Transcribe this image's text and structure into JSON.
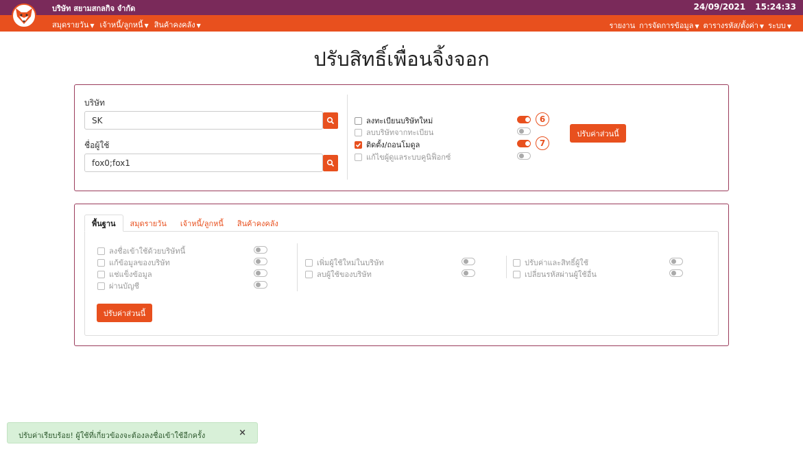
{
  "header": {
    "company": "บริษัท สยามสกลกิจ จำกัด",
    "date": "24/09/2021",
    "time": "15:24:33",
    "logo_icon": "fox-icon"
  },
  "menu": {
    "left": [
      {
        "label": "สมุดรายวัน",
        "has_caret": true
      },
      {
        "label": "เจ้าหนี้/ลูกหนี้",
        "has_caret": true
      },
      {
        "label": "สินค้าคงคลัง",
        "has_caret": true
      }
    ],
    "right": [
      {
        "label": "รายงาน",
        "has_caret": false
      },
      {
        "label": "การจัดการข้อมูล",
        "has_caret": true
      },
      {
        "label": "ตารางรหัส/ตั้งค่า",
        "has_caret": true
      },
      {
        "label": "ระบบ",
        "has_caret": true
      }
    ]
  },
  "page": {
    "title": "ปรับสิทธิ์เพื่อนจิ้งจอก"
  },
  "form": {
    "company_label": "บริษัท",
    "company_value": "SK",
    "user_label": "ชื่อผู้ใช้",
    "user_value": "fox0;fox1"
  },
  "top_permissions": [
    {
      "label": "ลงทะเบียนบริษัทใหม่",
      "checked": false,
      "enabled": true,
      "toggle_on": true,
      "badge": "6"
    },
    {
      "label": "ลบบริษัทจากทะเบียน",
      "checked": false,
      "enabled": false,
      "toggle_on": false,
      "badge": ""
    },
    {
      "label": "ติดตั้ง/ถอนโมดูล",
      "checked": true,
      "enabled": true,
      "toggle_on": true,
      "badge": "7"
    },
    {
      "label": "แก้ไขผู้ดูแลระบบคูนิฟ็อกซ์",
      "checked": false,
      "enabled": false,
      "toggle_on": false,
      "badge": ""
    }
  ],
  "buttons": {
    "apply_top": "ปรับค่าส่วนนี้",
    "apply_bottom": "ปรับค่าส่วนนี้"
  },
  "tabs": [
    {
      "label": "พื้นฐาน",
      "active": true
    },
    {
      "label": "สมุดรายวัน",
      "active": false
    },
    {
      "label": "เจ้าหนี้/ลูกหนี้",
      "active": false
    },
    {
      "label": "สินค้าคงคลัง",
      "active": false
    }
  ],
  "basic_permissions": {
    "col1": [
      {
        "label": "ลงชื่อเข้าใช้ด้วยบริษัทนี้"
      },
      {
        "label": "แก้ข้อมูลของบริษัท"
      },
      {
        "label": "แช่แข็งข้อมูล"
      },
      {
        "label": "ผ่านบัญชี"
      }
    ],
    "col2": [
      {
        "label": "เพิ่มผู้ใช้ใหม่ในบริษัท"
      },
      {
        "label": "ลบผู้ใช้ของบริษัท"
      }
    ],
    "col3": [
      {
        "label": "ปรับค่าและสิทธิ์ผู้ใช้"
      },
      {
        "label": "เปลี่ยนรหัสผ่านผู้ใช้อื่น"
      }
    ]
  },
  "toast": {
    "message": "ปรับค่าเรียบร้อย! ผู้ใช้ที่เกี่ยวข้องจะต้องลงชื่อเข้าใช้อีกครั้ง",
    "close": "×"
  },
  "colors": {
    "topbar": "#7a2a5a",
    "menubar": "#e8501e",
    "accent": "#e8501e",
    "panel_border": "#9a3a5a",
    "toast_bg": "#d8f0d8"
  }
}
